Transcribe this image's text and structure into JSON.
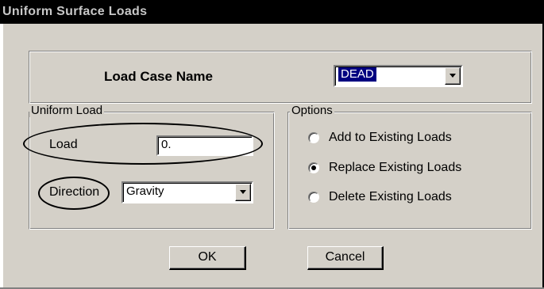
{
  "window": {
    "title": "Uniform Surface Loads"
  },
  "load_case": {
    "label": "Load Case Name",
    "selected": "DEAD"
  },
  "uniform_load": {
    "group_title": "Uniform Load",
    "load_label": "Load",
    "load_value": "0.",
    "direction_label": "Direction",
    "direction_value": "Gravity"
  },
  "options": {
    "group_title": "Options",
    "items": [
      {
        "label": "Add to Existing Loads",
        "checked": false
      },
      {
        "label": "Replace Existing Loads",
        "checked": true
      },
      {
        "label": "Delete Existing Loads",
        "checked": false
      }
    ]
  },
  "buttons": {
    "ok": "OK",
    "cancel": "Cancel"
  },
  "icons": {
    "dropdown": "chevron-down-icon",
    "radio_checked": "radio-checked-icon",
    "radio_unchecked": "radio-unchecked-icon"
  },
  "colors": {
    "dialog_background": "#d4d0c8",
    "title_bar": "#000000",
    "title_text": "#c8c8c8",
    "selection_highlight": "#000080"
  }
}
